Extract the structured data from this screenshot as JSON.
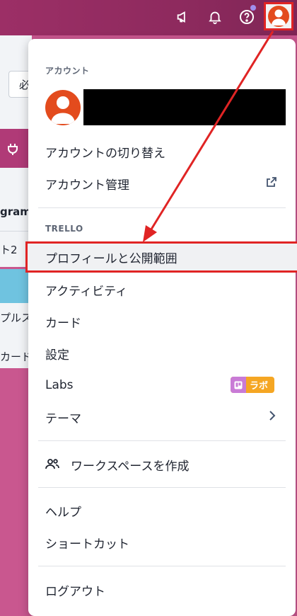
{
  "topbar": {
    "icons": [
      "megaphone-icon",
      "bell-icon",
      "help-icon",
      "avatar"
    ]
  },
  "background": {
    "btn_text": "必",
    "row1": "gram",
    "row2": "ト2",
    "row3": "プルス",
    "row4": "カード"
  },
  "menu": {
    "account_section": "アカウント",
    "switch_account": "アカウントの切り替え",
    "manage_account": "アカウント管理",
    "trello_section": "TRELLO",
    "profile": "プロフィールと公開範囲",
    "activity": "アクティビティ",
    "cards": "カード",
    "settings": "設定",
    "labs": "Labs",
    "labs_badge": "ラボ",
    "theme": "テーマ",
    "create_workspace": "ワークスペースを作成",
    "help": "ヘルプ",
    "shortcuts": "ショートカット",
    "logout": "ログアウト"
  },
  "colors": {
    "topbar": "#8e2a5e",
    "avatar": "#e34b1d",
    "highlight_border": "#e02424",
    "labs_badge": "#f5a623"
  }
}
